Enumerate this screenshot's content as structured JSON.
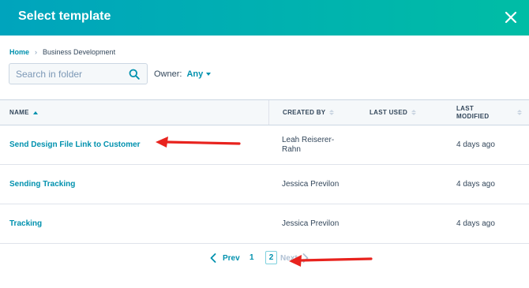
{
  "modal": {
    "title": "Select template",
    "close_icon": "close-icon"
  },
  "breadcrumb": {
    "home": "Home",
    "separator": "›",
    "current": "Business Development"
  },
  "search": {
    "placeholder": "Search in folder",
    "value": "",
    "icon": "search-icon"
  },
  "owner_filter": {
    "label": "Owner:",
    "value": "Any"
  },
  "table": {
    "columns": {
      "name": "NAME",
      "created_by": "CREATED BY",
      "last_used": "LAST USED",
      "last_modified_line1": "LAST",
      "last_modified_line2": "MODIFIED"
    },
    "rows": [
      {
        "name": "Send Design File Link to Customer",
        "created_by_line1": "Leah Reiserer-",
        "created_by_line2": "Rahn",
        "last_used": "",
        "last_modified": "4 days ago"
      },
      {
        "name": "Sending Tracking",
        "created_by_line1": "Jessica Previlon",
        "created_by_line2": "",
        "last_used": "",
        "last_modified": "4 days ago"
      },
      {
        "name": "Tracking",
        "created_by_line1": "Jessica Previlon",
        "created_by_line2": "",
        "last_used": "",
        "last_modified": "4 days ago"
      }
    ]
  },
  "pagination": {
    "prev": "Prev",
    "pages": [
      "1",
      "2"
    ],
    "current_page": "2",
    "next": "Next"
  },
  "colors": {
    "header_gradient_start": "#00a4bd",
    "header_gradient_end": "#00bda5",
    "link": "#0091ae",
    "annotation_arrow": "#e8231e"
  }
}
